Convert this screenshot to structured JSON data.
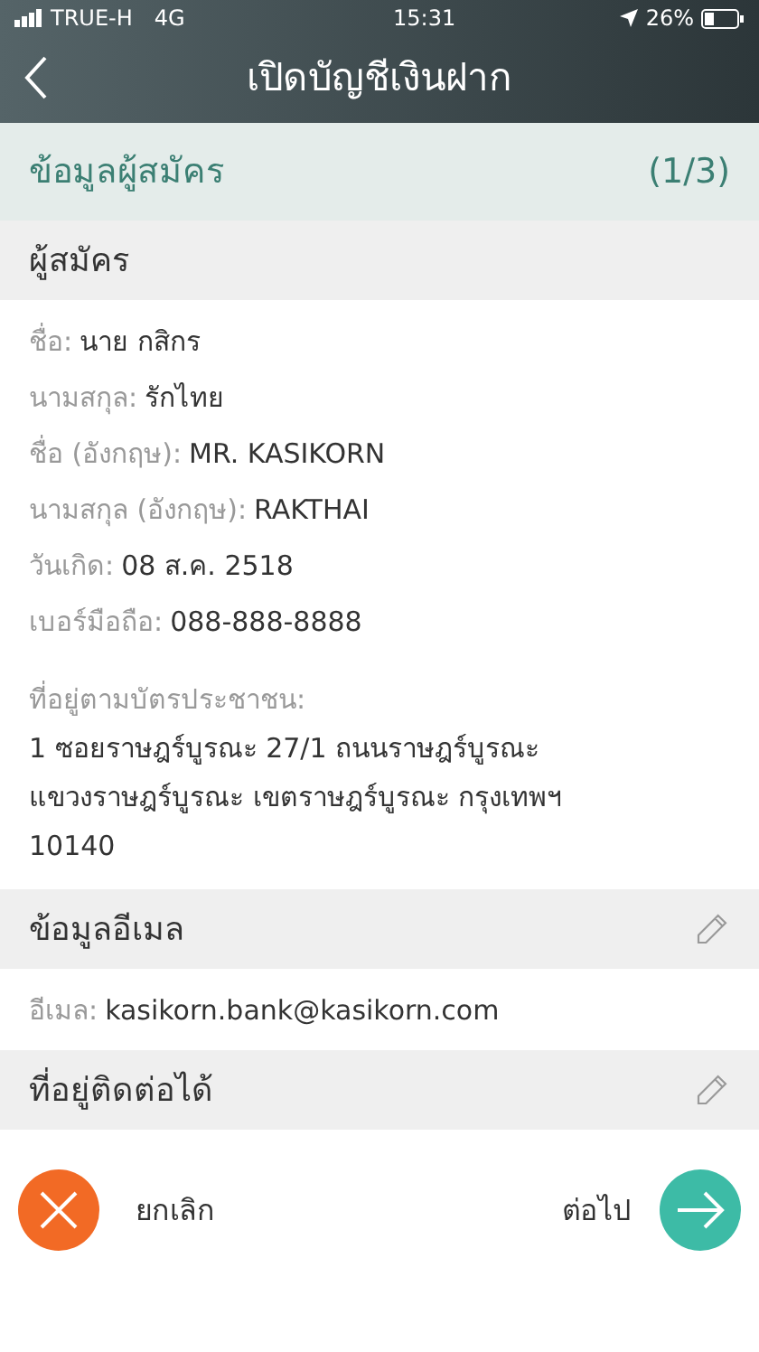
{
  "status_bar": {
    "carrier": "TRUE-H",
    "network": "4G",
    "time": "15:31",
    "battery": "26%"
  },
  "header": {
    "title": "เปิดบัญชีเงินฝาก"
  },
  "step": {
    "title": "ข้อมูลผู้สมัคร",
    "progress": "(1/3)"
  },
  "sections": [
    {
      "title": "ผู้สมัคร",
      "editable": false,
      "fields": [
        {
          "label": "ชื่อ:",
          "value": "นาย กสิกร"
        },
        {
          "label": "นามสกุล:",
          "value": "รักไทย"
        },
        {
          "label": "ชื่อ (อังกฤษ):",
          "value": "MR. KASIKORN"
        },
        {
          "label": "นามสกุล (อังกฤษ):",
          "value": "RAKTHAI"
        },
        {
          "label": "วันเกิด:",
          "value": "08 ส.ค. 2518"
        },
        {
          "label": "เบอร์มือถือ:",
          "value": "088-888-8888"
        }
      ],
      "address": {
        "label": "ที่อยู่ตามบัตรประชาชน:",
        "lines": [
          "1 ซอยราษฎร์บูรณะ 27/1 ถนนราษฎร์บูรณะ",
          "แขวงราษฎร์บูรณะ เขตราษฎร์บูรณะ กรุงเทพฯ",
          "10140"
        ]
      }
    },
    {
      "title": "ข้อมูลอีเมล",
      "editable": true,
      "fields": [
        {
          "label": "อีเมล:",
          "value": "kasikorn.bank@kasikorn.com"
        }
      ]
    },
    {
      "title": "ที่อยู่ติดต่อได้",
      "editable": true
    }
  ],
  "actions": {
    "cancel": "ยกเลิก",
    "next": "ต่อไป"
  }
}
